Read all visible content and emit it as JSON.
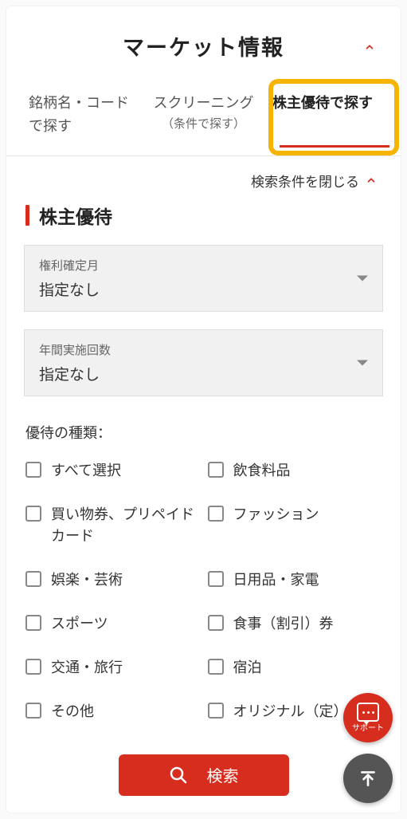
{
  "header": {
    "title": "マーケット情報"
  },
  "tabs": [
    {
      "label": "銘柄名・コードで探す",
      "sub": ""
    },
    {
      "label": "スクリーニング",
      "sub": "（条件で探す）"
    },
    {
      "label": "株主優待で探す",
      "sub": ""
    }
  ],
  "active_tab_index": 2,
  "close_search_label": "検索条件を閉じる",
  "section": {
    "title": "株主優待"
  },
  "selects": {
    "right_month": {
      "label": "権利確定月",
      "value": "指定なし"
    },
    "annual_count": {
      "label": "年間実施回数",
      "value": "指定なし"
    }
  },
  "types_label": "優待の種類：",
  "checkboxes": [
    "すべて選択",
    "飲食料品",
    "買い物券、プリペイドカード",
    "ファッション",
    "娯楽・芸術",
    "日用品・家電",
    "スポーツ",
    "食事（割引）券",
    "交通・旅行",
    "宿泊",
    "その他",
    "オリジナル（定）"
  ],
  "buttons": {
    "search": "検索",
    "support": "サポート"
  },
  "colors": {
    "accent": "#d62d1f",
    "highlight": "#f6b400"
  }
}
